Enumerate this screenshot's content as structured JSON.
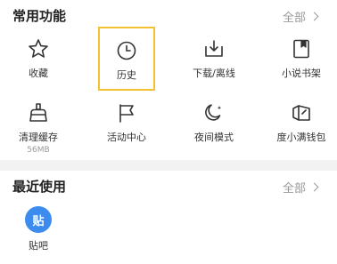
{
  "common": {
    "title": "常用功能",
    "more": "全部",
    "items": [
      {
        "label": "收藏",
        "icon": "star-icon"
      },
      {
        "label": "历史",
        "icon": "clock-icon"
      },
      {
        "label": "下载/离线",
        "icon": "download-icon"
      },
      {
        "label": "小说书架",
        "icon": "bookmark-book-icon"
      },
      {
        "label": "清理缓存",
        "icon": "broom-icon",
        "sub": "56MB"
      },
      {
        "label": "活动中心",
        "icon": "flag-icon"
      },
      {
        "label": "夜间模式",
        "icon": "moon-icon"
      },
      {
        "label": "度小满钱包",
        "icon": "wallet-icon"
      }
    ]
  },
  "recent": {
    "title": "最近使用",
    "more": "全部",
    "items": [
      {
        "label": "贴吧",
        "icon_text": "贴",
        "icon": "tieba-icon"
      }
    ]
  },
  "colors": {
    "highlight": "#f2c230",
    "tieba": "#3c8cf0"
  }
}
